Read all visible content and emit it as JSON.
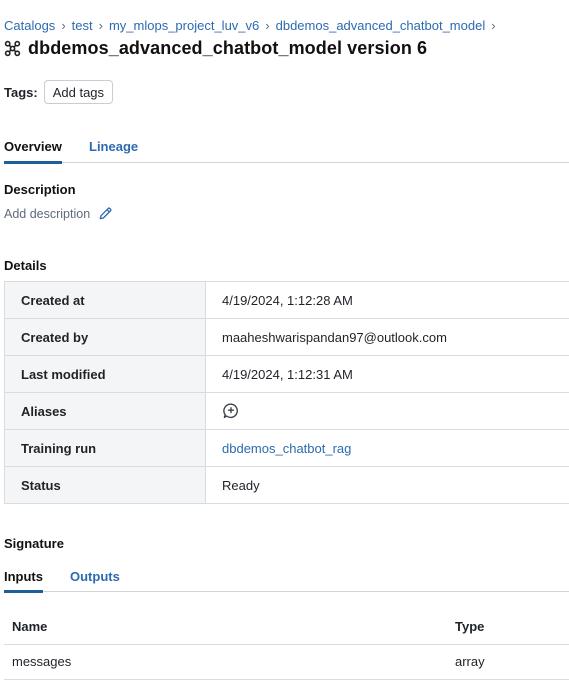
{
  "breadcrumb": {
    "items": [
      "Catalogs",
      "test",
      "my_mlops_project_luv_v6",
      "dbdemos_advanced_chatbot_model"
    ],
    "separator": "›"
  },
  "page": {
    "title": "dbdemos_advanced_chatbot_model version 6",
    "icon": "model-icon"
  },
  "tags": {
    "label": "Tags:",
    "add_button": "Add tags"
  },
  "tabs": {
    "overview": "Overview",
    "lineage": "Lineage",
    "active": "Overview"
  },
  "description": {
    "heading": "Description",
    "placeholder": "Add description",
    "edit_icon": "pencil-icon"
  },
  "details": {
    "heading": "Details",
    "rows": [
      {
        "key": "Created at",
        "value": "4/19/2024, 1:12:28 AM"
      },
      {
        "key": "Created by",
        "value": "maaheshwarispandan97@outlook.com"
      },
      {
        "key": "Last modified",
        "value": "4/19/2024, 1:12:31 AM"
      },
      {
        "key": "Aliases",
        "icon": "add-comment-icon"
      },
      {
        "key": "Training run",
        "value": "dbdemos_chatbot_rag"
      },
      {
        "key": "Status",
        "value": "Ready"
      }
    ]
  },
  "signature": {
    "heading": "Signature",
    "tabs": {
      "inputs": "Inputs",
      "outputs": "Outputs",
      "active": "Inputs"
    },
    "columns": [
      "Name",
      "Type"
    ],
    "rows": [
      {
        "name": "messages",
        "type": "array"
      }
    ]
  },
  "colors": {
    "link": "#2c6bb0",
    "active_tab_underline": "#1f5f99",
    "key_cell_bg": "#f4f5f6"
  }
}
